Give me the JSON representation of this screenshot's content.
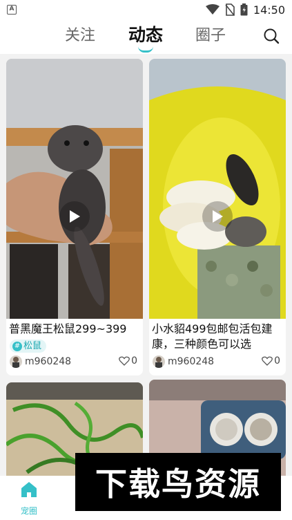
{
  "status_bar": {
    "time": "14:50"
  },
  "top_tabs": [
    {
      "label": "关注"
    },
    {
      "label": "动态"
    },
    {
      "label": "圈子"
    }
  ],
  "feed": [
    {
      "title": "普黑魔王松鼠299~399",
      "tag": "松鼠",
      "author": "m960248",
      "likes": "0"
    },
    {
      "title": "小水貂499包邮包活包建康，三种颜色可以选",
      "author": "m960248",
      "likes": "0"
    }
  ],
  "bottom_nav": [
    {
      "label": "宠圈",
      "icon": "home-icon"
    },
    {
      "label": "",
      "icon": "nav-icon-2"
    },
    {
      "label": "",
      "icon": "nav-icon-3"
    },
    {
      "label": "",
      "icon": "nav-icon-4"
    },
    {
      "label": "",
      "icon": "nav-icon-5"
    }
  ],
  "watermark": {
    "text": "下载鸟资源"
  },
  "colors": {
    "accent": "#35c0c8",
    "tag_bg": "#e3f5f6",
    "background": "#f2f2f2"
  }
}
